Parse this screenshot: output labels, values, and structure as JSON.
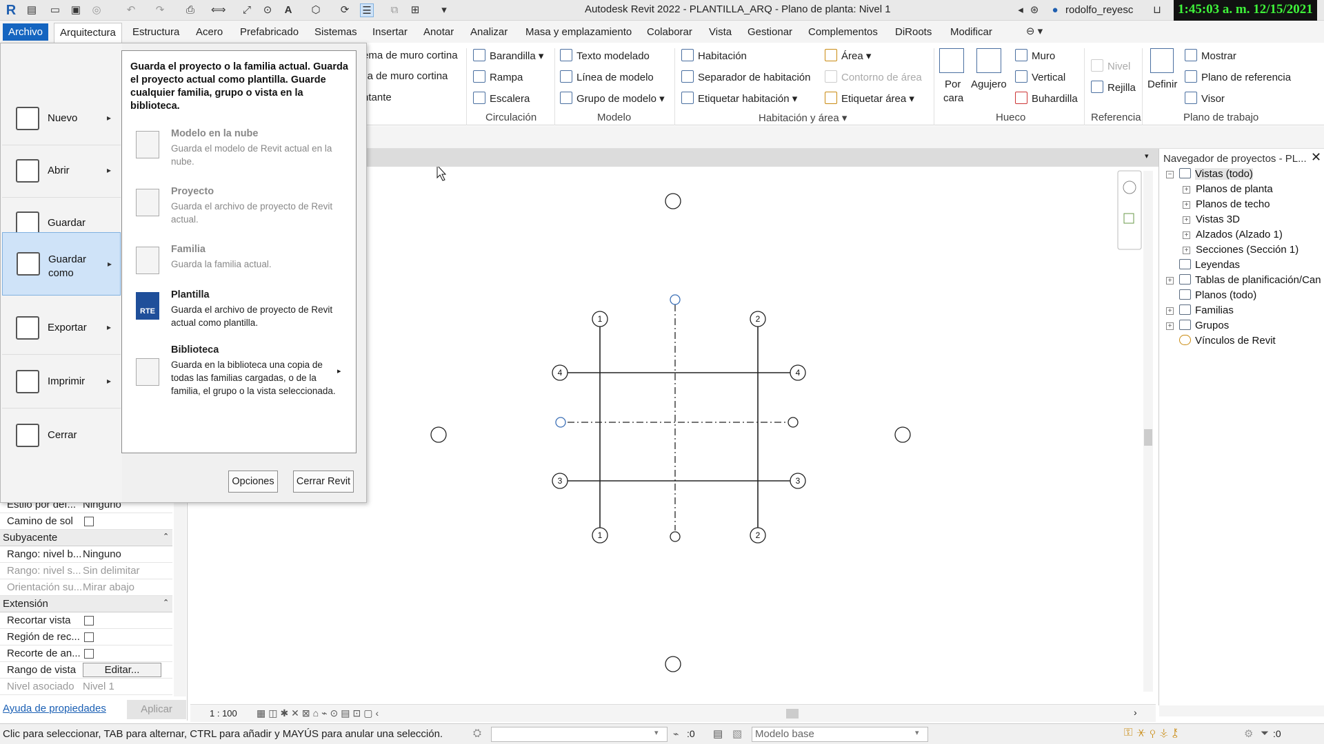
{
  "window": {
    "title": "Autodesk Revit 2022 - PLANTILLA_ARQ - Plano de planta: Nivel 1",
    "user": "rodolfo_reyesc",
    "clock": "1:45:03 a. m. 12/15/2021"
  },
  "tabs": [
    "Archivo",
    "Arquitectura",
    "Estructura",
    "Acero",
    "Prefabricado",
    "Sistemas",
    "Insertar",
    "Anotar",
    "Analizar",
    "Masa y emplazamiento",
    "Colaborar",
    "Vista",
    "Gestionar",
    "Complementos",
    "DiRoots",
    "Modificar"
  ],
  "ribbon": {
    "partial1": "ema de muro cortina",
    "partial2": "lla de muro cortina",
    "partial3": "ntante",
    "circulation": {
      "label": "Circulación",
      "items": [
        "Barandilla",
        "Rampa",
        "Escalera"
      ]
    },
    "model": {
      "label": "Modelo",
      "items": [
        "Texto modelado",
        "Línea de modelo",
        "Grupo de modelo"
      ]
    },
    "room_area": {
      "label": "Habitación y área",
      "items": [
        "Habitación",
        "Separador de habitación",
        "Etiquetar habitación",
        "Área",
        "Contorno de área",
        "Etiquetar área"
      ]
    },
    "opening": {
      "label": "Hueco",
      "por": "Por",
      "cara": "cara",
      "agujero": "Agujero",
      "items": [
        "Muro",
        "Vertical",
        "Buhardilla"
      ]
    },
    "reference": {
      "label": "Referencia",
      "nivel": "Nivel",
      "rejilla": "Rejilla"
    },
    "workplane": {
      "label": "Plano de trabajo",
      "definir": "Definir",
      "items": [
        "Mostrar",
        "Plano de referencia",
        "Visor"
      ]
    }
  },
  "file_menu": {
    "items": [
      "Nuevo",
      "Abrir",
      "Guardar",
      "Guardar como",
      "Exportar",
      "Imprimir",
      "Cerrar"
    ],
    "guardar_como_l1": "Guardar",
    "guardar_como_l2": "como",
    "description": "Guarda el proyecto o la familia actual. Guarda el proyecto actual como plantilla. Guarde cualquier familia, grupo o vista en la biblioteca.",
    "sub_options": [
      {
        "title": "Modelo en la nube",
        "desc": "Guarda el modelo de Revit actual en la nube."
      },
      {
        "title": "Proyecto",
        "desc": "Guarda el archivo de proyecto de Revit actual."
      },
      {
        "title": "Familia",
        "desc": "Guarda la familia actual."
      },
      {
        "title": "Plantilla",
        "desc": "Guarda el archivo de proyecto de Revit actual como plantilla."
      },
      {
        "title": "Biblioteca",
        "desc": "Guarda en la biblioteca una copia de todas las familias cargadas, o de la familia, el grupo o la vista seleccionada."
      }
    ],
    "options_button": "Opciones",
    "close_button": "Cerrar Revit",
    "rte_icon_text": "RTE"
  },
  "grid_labels": {
    "a": "1",
    "b": "2",
    "c": "3",
    "d": "4"
  },
  "navigator": {
    "title": "Navegador de proyectos - PL...",
    "items": [
      "Vistas (todo)",
      "Planos de planta",
      "Planos de techo",
      "Vistas 3D",
      "Alzados (Alzado 1)",
      "Secciones (Sección 1)",
      "Leyendas",
      "Tablas de planificación/Can",
      "Planos (todo)",
      "Familias",
      "Grupos",
      "Vínculos de Revit"
    ]
  },
  "properties": {
    "rows": [
      {
        "label": "Estilo por def...",
        "value": "Ninguno"
      },
      {
        "label": "Camino de sol",
        "value": ""
      },
      {
        "section": "Subyacente"
      },
      {
        "label": "Rango: nivel b...",
        "value": "Ninguno"
      },
      {
        "label": "Rango: nivel s...",
        "value": "Sin delimitar"
      },
      {
        "label": "Orientación su...",
        "value": "Mirar abajo"
      },
      {
        "section": "Extensión"
      },
      {
        "label": "Recortar vista",
        "value": ""
      },
      {
        "label": "Región de rec...",
        "value": ""
      },
      {
        "label": "Recorte de an...",
        "value": ""
      },
      {
        "label": "Rango de vista",
        "value": "Editar..."
      },
      {
        "label": "Nivel asociado",
        "value": "Nivel 1"
      }
    ],
    "help_link": "Ayuda de propiedades",
    "apply_button": "Aplicar"
  },
  "view_bar": {
    "scale": "1 : 100"
  },
  "status": {
    "text": "Clic para seleccionar, TAB para alternar, CTRL para añadir y MAYÚS para anular una selección.",
    "selection_count": ":0",
    "model": "Modelo base",
    "filter_count": ":0"
  }
}
